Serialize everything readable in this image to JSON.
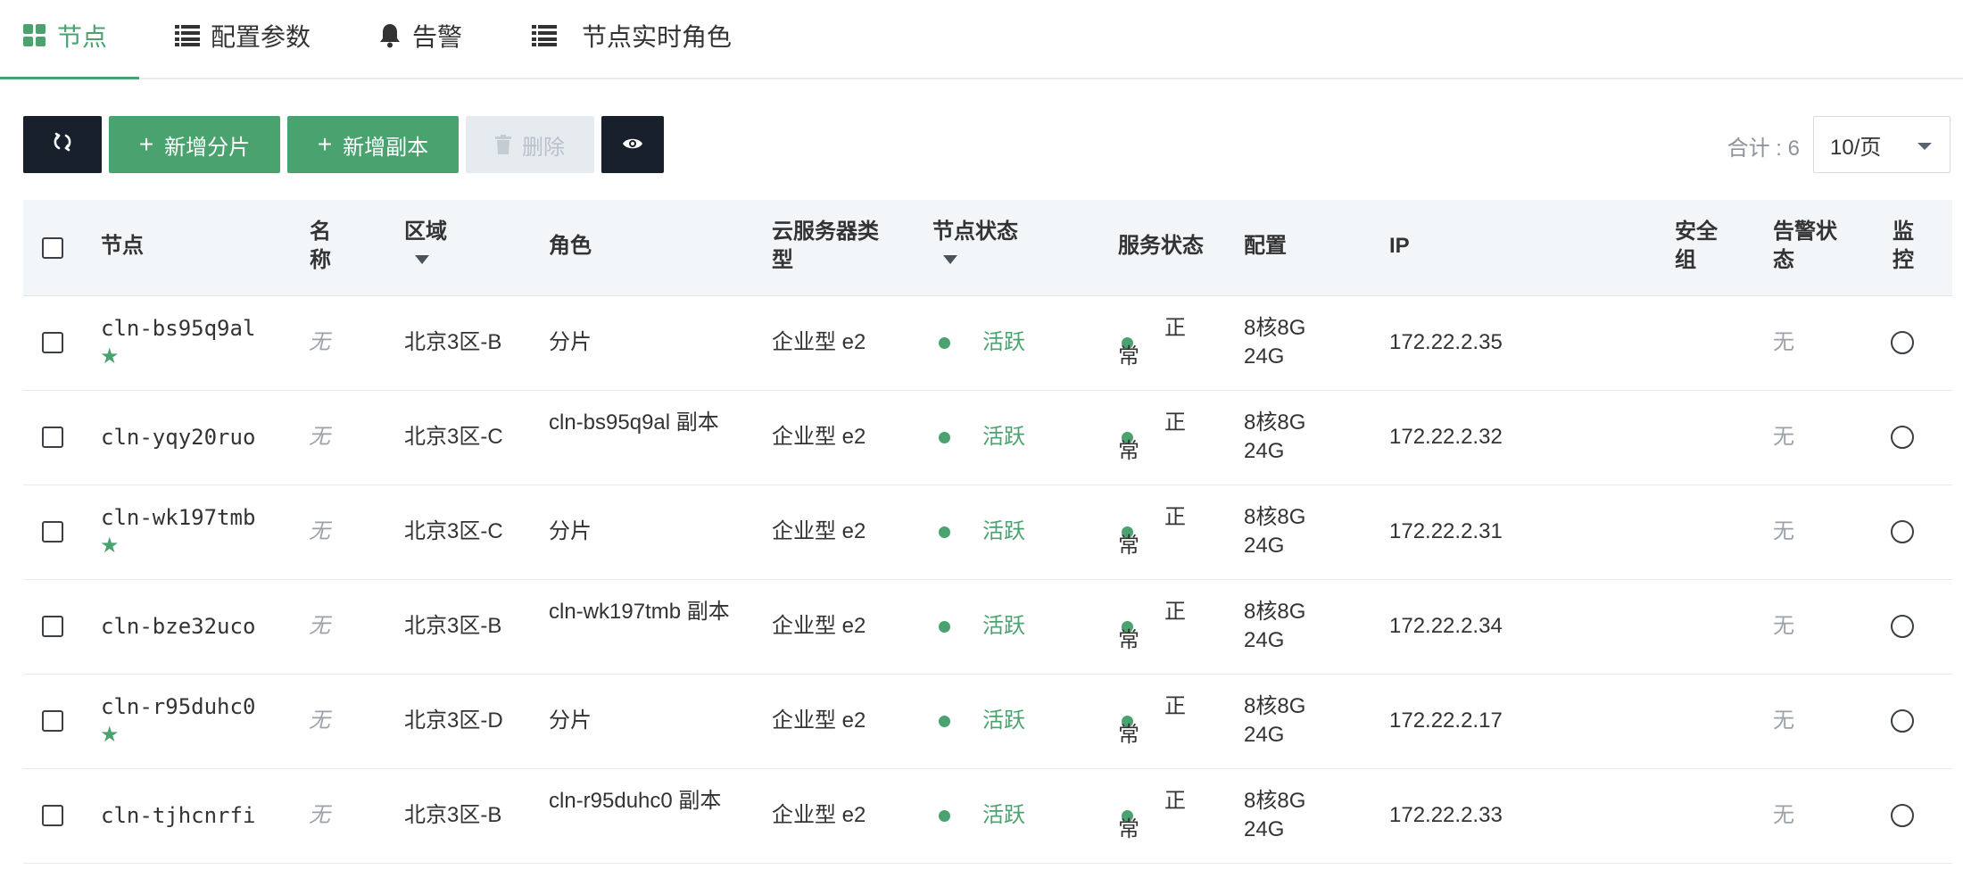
{
  "tabs": [
    {
      "label": "节点",
      "icon": "grid-icon"
    },
    {
      "label": "配置参数",
      "icon": "list-icon"
    },
    {
      "label": "告警",
      "icon": "bell-icon"
    },
    {
      "label": "节点实时角色",
      "icon": "list-icon"
    }
  ],
  "toolbar": {
    "refresh_icon": "refresh-icon",
    "add_shard_label": "新增分片",
    "add_replica_label": "新增副本",
    "delete_label": "删除",
    "view_icon": "eye-icon",
    "total_label": "合计 : 6",
    "page_size": "10/页"
  },
  "columns": {
    "node": "节点",
    "name": "名称",
    "zone": "区域",
    "role": "角色",
    "server_type": "云服务器类型",
    "node_status": "节点状态",
    "service_status": "服务状态",
    "config": "配置",
    "ip": "IP",
    "security_group": "安全组",
    "alarm_status": "告警状态",
    "monitor": "监控"
  },
  "rows": [
    {
      "node": "cln-bs95q9al",
      "star": true,
      "name": "无",
      "zone": "北京3区-B",
      "role": "分片",
      "server_type": "企业型 e2",
      "node_status": "活跃",
      "service_status": "正常",
      "config": "8核8G\n24G",
      "ip": "172.22.2.35",
      "security_group": "",
      "alarm_status": "无"
    },
    {
      "node": "cln-yqy20ruo",
      "star": false,
      "name": "无",
      "zone": "北京3区-C",
      "role": "cln-bs95q9al 副本",
      "server_type": "企业型 e2",
      "node_status": "活跃",
      "service_status": "正常",
      "config": "8核8G\n24G",
      "ip": "172.22.2.32",
      "security_group": "",
      "alarm_status": "无"
    },
    {
      "node": "cln-wk197tmb",
      "star": true,
      "name": "无",
      "zone": "北京3区-C",
      "role": "分片",
      "server_type": "企业型 e2",
      "node_status": "活跃",
      "service_status": "正常",
      "config": "8核8G\n24G",
      "ip": "172.22.2.31",
      "security_group": "",
      "alarm_status": "无"
    },
    {
      "node": "cln-bze32uco",
      "star": false,
      "name": "无",
      "zone": "北京3区-B",
      "role": "cln-wk197tmb 副本",
      "server_type": "企业型 e2",
      "node_status": "活跃",
      "service_status": "正常",
      "config": "8核8G\n24G",
      "ip": "172.22.2.34",
      "security_group": "",
      "alarm_status": "无"
    },
    {
      "node": "cln-r95duhc0",
      "star": true,
      "name": "无",
      "zone": "北京3区-D",
      "role": "分片",
      "server_type": "企业型 e2",
      "node_status": "活跃",
      "service_status": "正常",
      "config": "8核8G\n24G",
      "ip": "172.22.2.17",
      "security_group": "",
      "alarm_status": "无"
    },
    {
      "node": "cln-tjhcnrfi",
      "star": false,
      "name": "无",
      "zone": "北京3区-B",
      "role": "cln-r95duhc0 副本",
      "server_type": "企业型 e2",
      "node_status": "活跃",
      "service_status": "正常",
      "config": "8核8G\n24G",
      "ip": "172.22.2.33",
      "security_group": "",
      "alarm_status": "无"
    }
  ],
  "colors": {
    "accent": "#4aa36f",
    "dark": "#17202b",
    "disabled": "#e6ebf0",
    "header_bg": "#f3f6f9"
  }
}
